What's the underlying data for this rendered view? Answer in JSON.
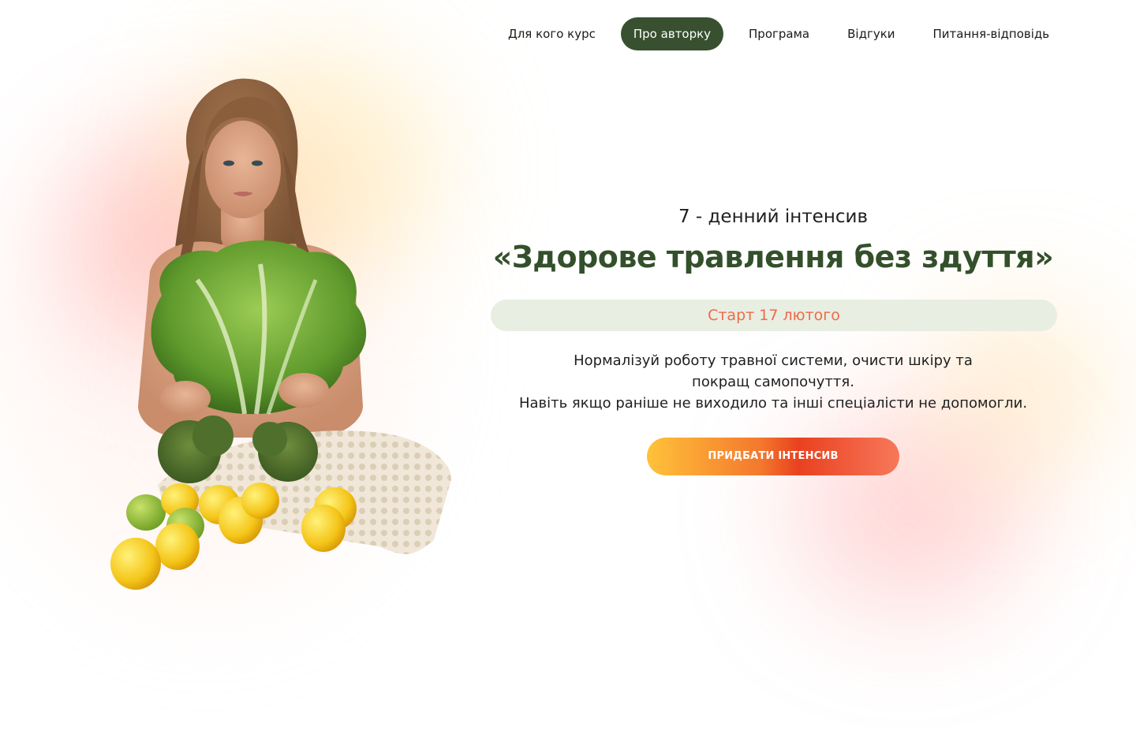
{
  "nav": {
    "items": [
      {
        "label": "Для кого курс"
      },
      {
        "label": "Про авторку"
      },
      {
        "label": "Програма"
      },
      {
        "label": "Відгуки"
      },
      {
        "label": "Питання-відповідь"
      }
    ],
    "active_index": 1
  },
  "hero": {
    "eyebrow": "7 - денний інтенсив",
    "title": "«Здорове травлення без здуття»",
    "start_badge": "Старт 17 лютого",
    "description_lines": [
      "Нормалізуй роботу травної системи, очисти шкіру та",
      "покращ самопочуття.",
      "Навіть якщо раніше не виходило та інші спеціалісти не допомогли."
    ],
    "cta_label": "ПРИДБАТИ ІНТЕНСИВ"
  },
  "colors": {
    "brand_green": "#33502b",
    "nav_active_bg": "#38502f",
    "accent_orange": "#ee6a4a",
    "pill_bg": "#e8eee1",
    "cta_gradient_start": "#ffc23a",
    "cta_gradient_end": "#f7785a"
  }
}
